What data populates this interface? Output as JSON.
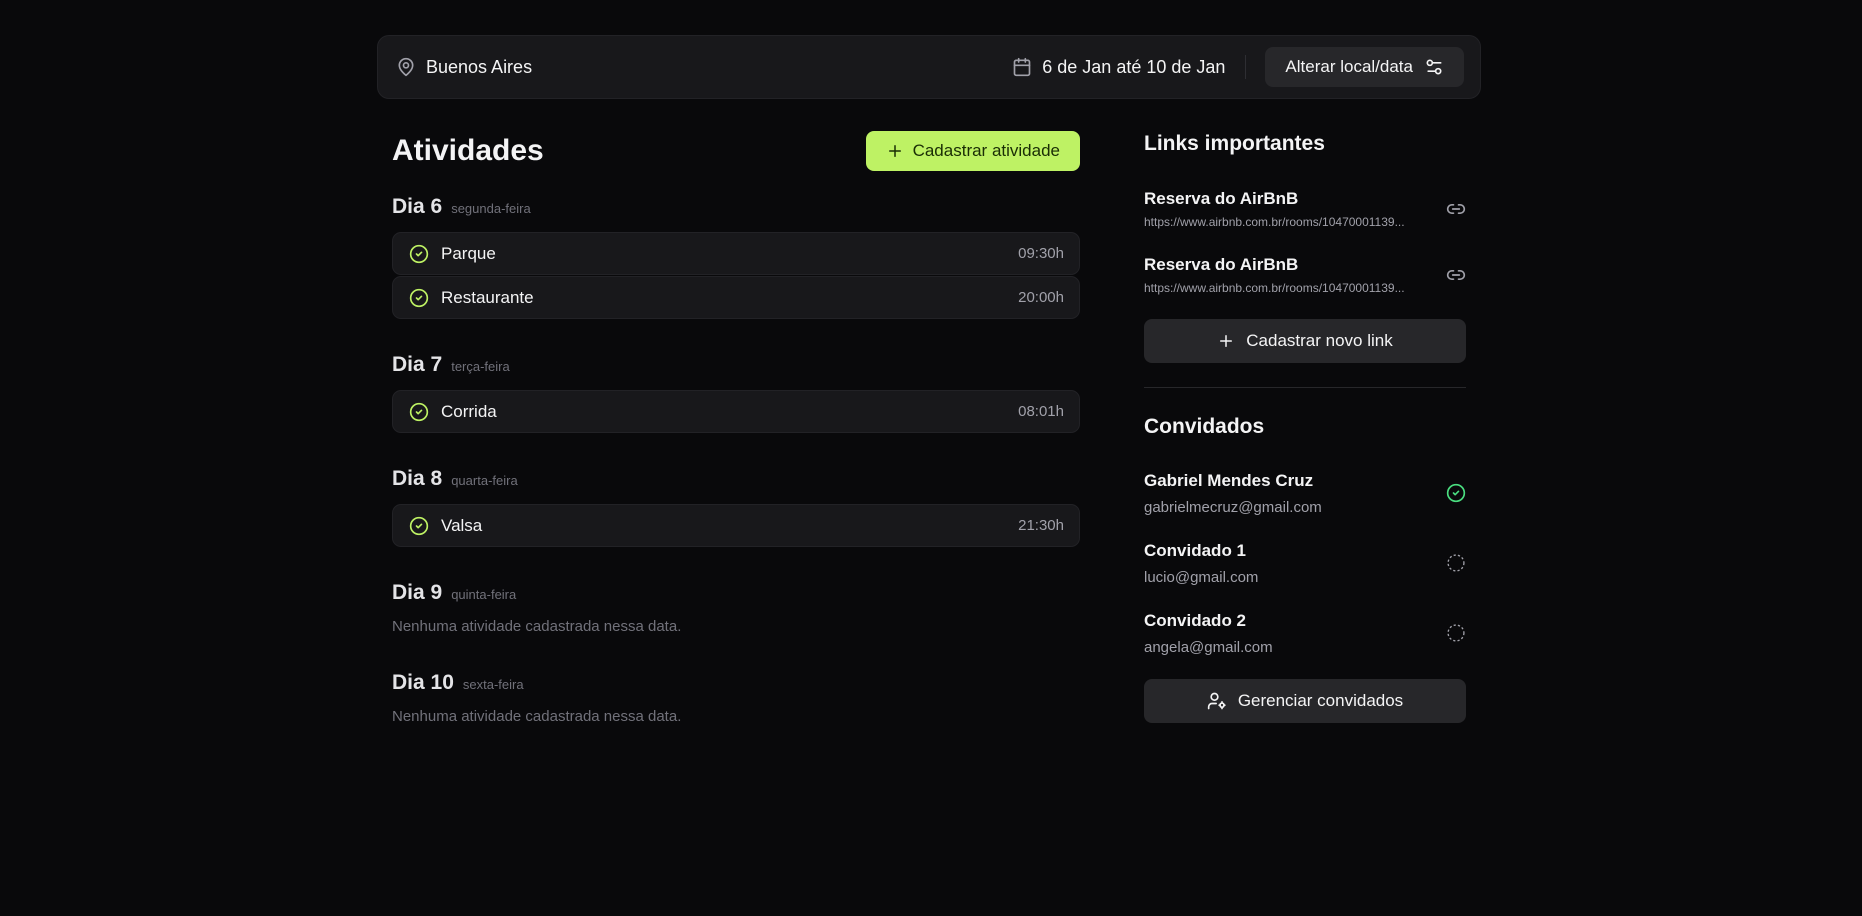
{
  "header": {
    "location": "Buenos Aires",
    "date_range": "6 de Jan até 10 de Jan",
    "change_button": "Alterar local/data"
  },
  "activities": {
    "title": "Atividades",
    "add_button": "Cadastrar atividade",
    "empty_message": "Nenhuma atividade cadastrada nessa data.",
    "days": [
      {
        "label": "Dia 6",
        "weekday": "segunda-feira",
        "items": [
          {
            "name": "Parque",
            "time": "09:30h"
          },
          {
            "name": "Restaurante",
            "time": "20:00h"
          }
        ]
      },
      {
        "label": "Dia 7",
        "weekday": "terça-feira",
        "items": [
          {
            "name": "Corrida",
            "time": "08:01h"
          }
        ]
      },
      {
        "label": "Dia 8",
        "weekday": "quarta-feira",
        "items": [
          {
            "name": "Valsa",
            "time": "21:30h"
          }
        ]
      },
      {
        "label": "Dia 9",
        "weekday": "quinta-feira",
        "items": []
      },
      {
        "label": "Dia 10",
        "weekday": "sexta-feira",
        "items": []
      }
    ]
  },
  "links": {
    "title": "Links importantes",
    "items": [
      {
        "name": "Reserva do AirBnB",
        "url": "https://www.airbnb.com.br/rooms/10470001139..."
      },
      {
        "name": "Reserva do AirBnB",
        "url": "https://www.airbnb.com.br/rooms/10470001139..."
      }
    ],
    "add_button": "Cadastrar novo link"
  },
  "guests": {
    "title": "Convidados",
    "items": [
      {
        "name": "Gabriel Mendes Cruz",
        "email": "gabrielmecruz@gmail.com",
        "status": "confirmed"
      },
      {
        "name": "Convidado 1",
        "email": "lucio@gmail.com",
        "status": "pending"
      },
      {
        "name": "Convidado 2",
        "email": "angela@gmail.com",
        "status": "pending"
      }
    ],
    "manage_button": "Gerenciar convidados"
  },
  "colors": {
    "background": "#09090b",
    "accent": "#bef264",
    "confirmed": "#4ade80",
    "card": "#18181b"
  }
}
